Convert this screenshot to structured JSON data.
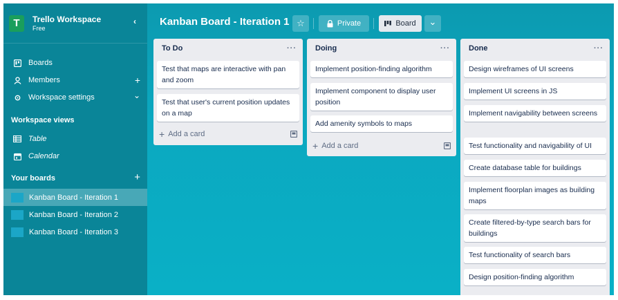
{
  "workspace": {
    "logo_letter": "T",
    "name": "Trello Workspace",
    "plan": "Free",
    "collapse_icon": "‹"
  },
  "nav": {
    "boards": "Boards",
    "members": "Members",
    "members_add": "+",
    "settings": "Workspace settings",
    "settings_chevron": "⌄"
  },
  "views": {
    "title": "Workspace views",
    "table": "Table",
    "calendar": "Calendar"
  },
  "your_boards": {
    "title": "Your boards",
    "add": "+",
    "items": [
      {
        "label": "Kanban Board - Iteration 1"
      },
      {
        "label": "Kanban Board - Iteration 2"
      },
      {
        "label": "Kanban Board - Iteration 3"
      }
    ]
  },
  "header": {
    "title": "Kanban Board - Iteration 1",
    "star": "☆",
    "visibility_label": "Private",
    "view_label": "Board",
    "view_dropdown": "⌄"
  },
  "lists": [
    {
      "title": "To Do",
      "menu": "···",
      "cards": [
        "Test that maps are interactive with pan and zoom",
        "Test that user's current position updates on a map"
      ],
      "add_card": "Add a card"
    },
    {
      "title": "Doing",
      "menu": "···",
      "cards": [
        "Implement position-finding algorithm",
        "Implement component to display user position",
        "Add amenity symbols to maps"
      ],
      "add_card": "Add a card"
    },
    {
      "title": "Done",
      "menu": "···",
      "cards": [
        "Design wireframes of UI screens",
        "Implement UI screens in JS",
        "Implement navigability between screens",
        "Test functionality and navigability of UI",
        "Create database table for buildings",
        "Implement floorplan images as building maps",
        "Create filtered-by-type search bars for buildings",
        "Test functionality of search bars",
        "Design position-finding algorithm"
      ]
    }
  ],
  "colors": {
    "sidebar": "#0a8598",
    "board_bg": "#0ba8c0",
    "logo": "#1a9e5c",
    "list_bg": "#ebecf0",
    "swatch": "#1ba6c7"
  }
}
